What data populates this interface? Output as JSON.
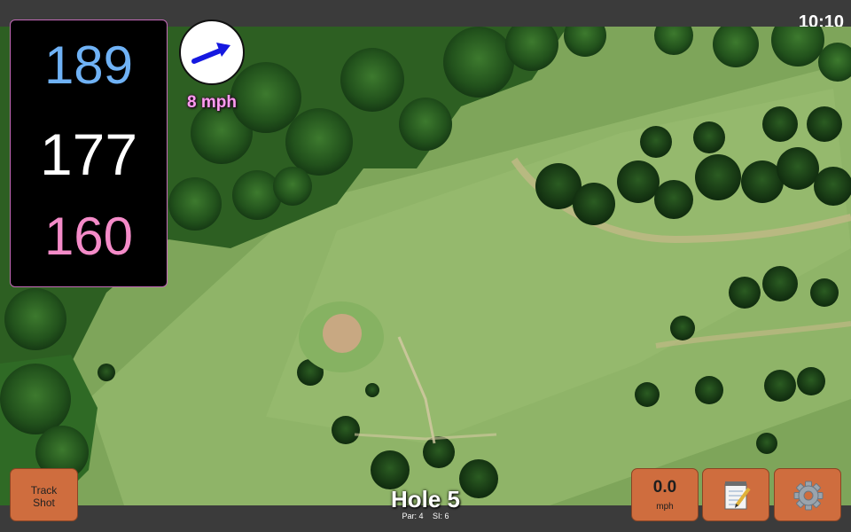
{
  "status_bar": {
    "time": "10:10"
  },
  "distances": {
    "back": "189",
    "center": "177",
    "front": "160"
  },
  "wind": {
    "speed_label": "8 mph",
    "direction_icon": "arrow-icon"
  },
  "hole": {
    "title": "Hole 5",
    "par": "Par: 4",
    "si": "SI: 6"
  },
  "buttons": {
    "track_shot_line1": "Track",
    "track_shot_line2": "Shot",
    "speed_value": "0.0",
    "speed_unit": "mph",
    "notes_icon": "notepad-icon",
    "settings_icon": "gear-icon"
  },
  "colors": {
    "back": "#6fb2f6",
    "center": "#ffffff",
    "front": "#f48bc8",
    "wind_label": "#ff9cf0",
    "button": "#cf6d3e"
  }
}
